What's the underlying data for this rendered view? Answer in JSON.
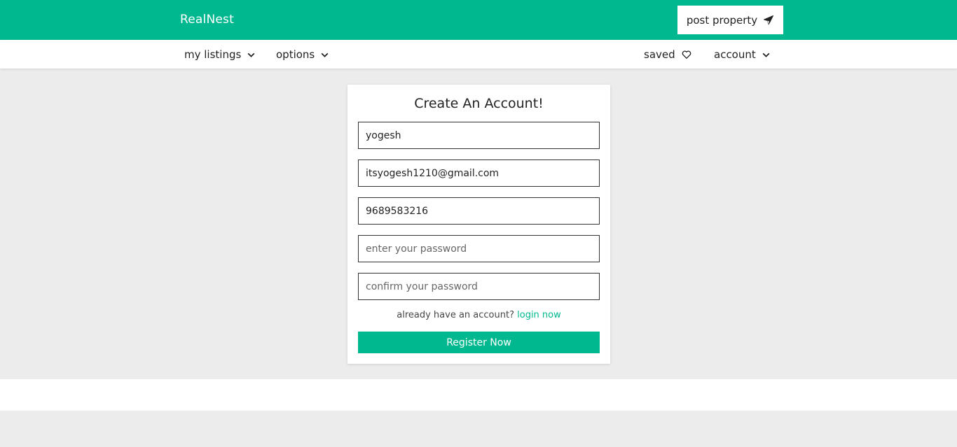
{
  "header": {
    "logo": "RealNest",
    "post_property_label": "post property",
    "post_property_icon": "paper-plane-icon"
  },
  "nav": {
    "my_listings": "my listings",
    "options": "options",
    "saved": "saved",
    "account": "account"
  },
  "form": {
    "title": "Create An Account!",
    "name_value": "yogesh",
    "email_value": "itsyogesh1210@gmail.com",
    "phone_value": "9689583216",
    "password_placeholder": "enter your password",
    "confirm_password_placeholder": "confirm your password",
    "login_prompt": "already have an account?",
    "login_link": "login now",
    "register_button": "Register Now"
  },
  "colors": {
    "brand": "#00b88f",
    "background": "#ececec"
  }
}
